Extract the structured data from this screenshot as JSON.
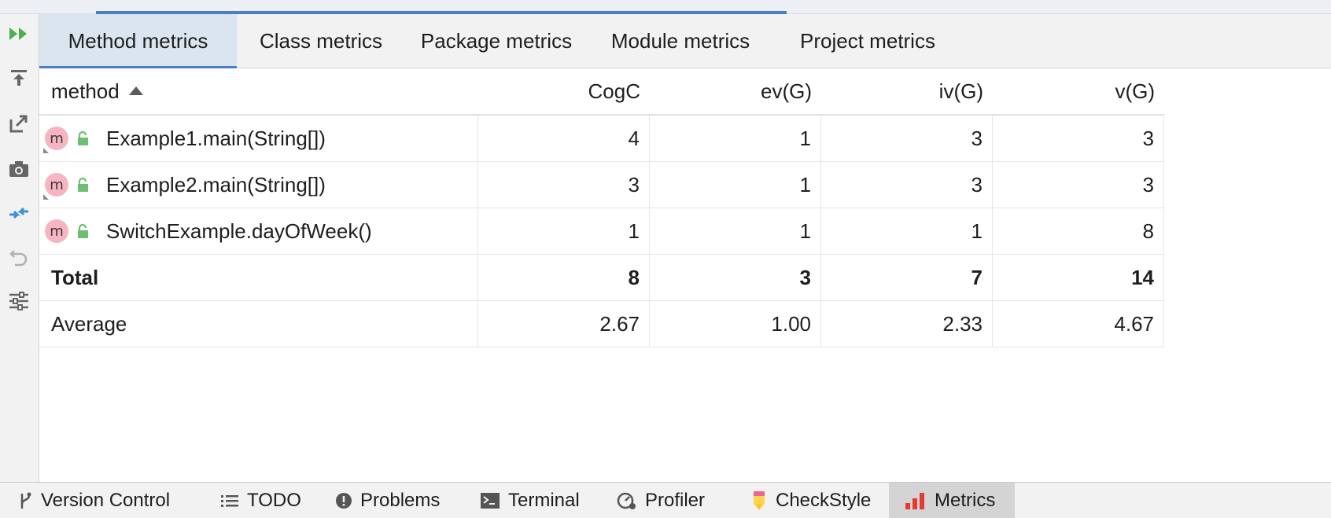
{
  "tabs": [
    {
      "label": "Method metrics",
      "active": true
    },
    {
      "label": "Class metrics",
      "active": false
    },
    {
      "label": "Package metrics",
      "active": false
    },
    {
      "label": "Module metrics",
      "active": false
    },
    {
      "label": "Project metrics",
      "active": false
    }
  ],
  "left_toolbar": [
    {
      "icon": "run-icon"
    },
    {
      "icon": "import-icon"
    },
    {
      "icon": "export-icon"
    },
    {
      "icon": "camera-icon"
    },
    {
      "icon": "collapse-icon"
    },
    {
      "icon": "undo-icon"
    },
    {
      "icon": "settings-icon"
    }
  ],
  "table": {
    "headers": [
      "method",
      "CogC",
      "ev(G)",
      "iv(G)",
      "v(G)"
    ],
    "sort_column": "method",
    "sort_direction": "ascending",
    "rows": [
      {
        "name": "Example1.main(String[])",
        "badge": "m",
        "values": [
          "4",
          "1",
          "3",
          "3"
        ]
      },
      {
        "name": "Example2.main(String[])",
        "badge": "m",
        "values": [
          "3",
          "1",
          "3",
          "3"
        ]
      },
      {
        "name": "SwitchExample.dayOfWeek()",
        "badge": "m",
        "values": [
          "1",
          "1",
          "1",
          "8"
        ]
      }
    ],
    "total": {
      "label": "Total",
      "values": [
        "8",
        "3",
        "7",
        "14"
      ]
    },
    "average": {
      "label": "Average",
      "values": [
        "2.67",
        "1.00",
        "2.33",
        "4.67"
      ]
    }
  },
  "bottom_tools": [
    {
      "label": "Version Control",
      "icon": "version-control-icon",
      "active": false
    },
    {
      "label": "TODO",
      "icon": "todo-icon",
      "active": false
    },
    {
      "label": "Problems",
      "icon": "problems-icon",
      "active": false
    },
    {
      "label": "Terminal",
      "icon": "terminal-icon",
      "active": false
    },
    {
      "label": "Profiler",
      "icon": "profiler-icon",
      "active": false
    },
    {
      "label": "CheckStyle",
      "icon": "checkstyle-icon",
      "active": false
    },
    {
      "label": "Metrics",
      "icon": "metrics-icon",
      "active": true
    }
  ],
  "colors": {
    "accent": "#4a7fc7",
    "active_tab_bg": "#dbe5ef",
    "method_badge": "#f6b5c0",
    "lock_green": "#6fbf73",
    "run_green": "#4caf50",
    "collapse_blue": "#3d8fd6"
  }
}
